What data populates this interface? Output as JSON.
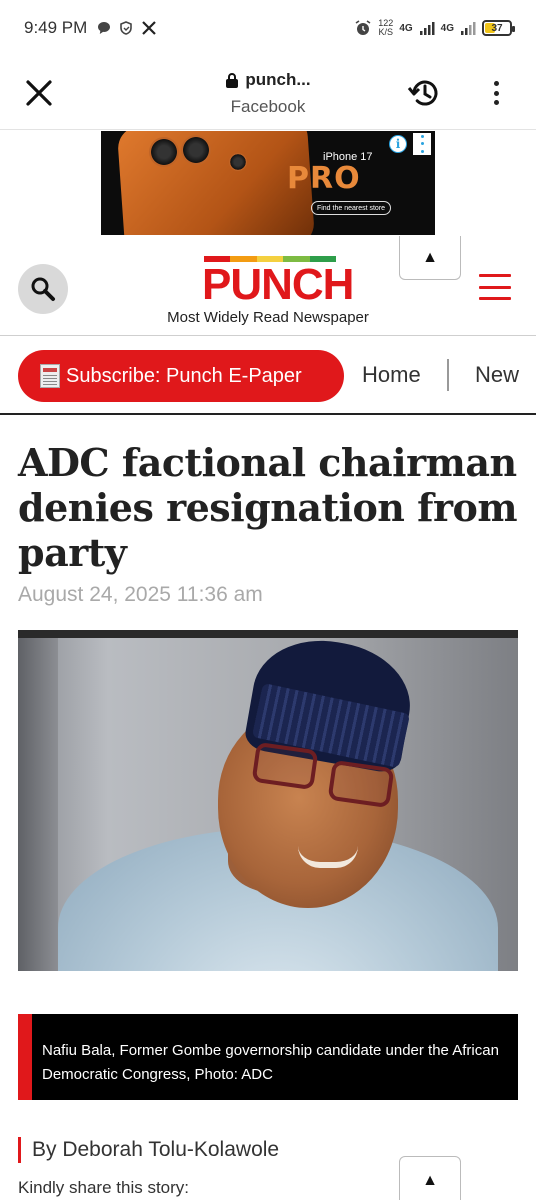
{
  "status_bar": {
    "time": "9:49 PM",
    "net_speed_value": "122",
    "net_speed_unit": "K/S",
    "signal1_label": "4G",
    "signal2_label": "4G",
    "battery": "37",
    "battery_level": 0.37
  },
  "browser": {
    "site_title": "punch...",
    "source": "Facebook"
  },
  "ad": {
    "brand": "iPhone 17",
    "model": "PRO",
    "cta": "Find the nearest store",
    "info": "i"
  },
  "site": {
    "logo": "PUNCH",
    "tagline": "Most Widely Read Newspaper",
    "scroll_top": "▲"
  },
  "nav": {
    "subscribe": "Subscribe: Punch E-Paper",
    "items": [
      "Home",
      "New"
    ]
  },
  "article": {
    "headline": "ADC factional chairman denies resignation from party",
    "date": "August 24, 2025 11:36 am",
    "caption": "Nafiu Bala, Former Gombe governorship candidate under the African Democratic Congress, Photo: ADC",
    "byline": "By Deborah Tolu-Kolawole",
    "share_prompt": "Kindly share this story:",
    "scroll_top": "▲"
  },
  "colors": {
    "brand_red": "#e0181b",
    "caption_bg": "#000000",
    "date_grey": "#a9a9a9"
  }
}
